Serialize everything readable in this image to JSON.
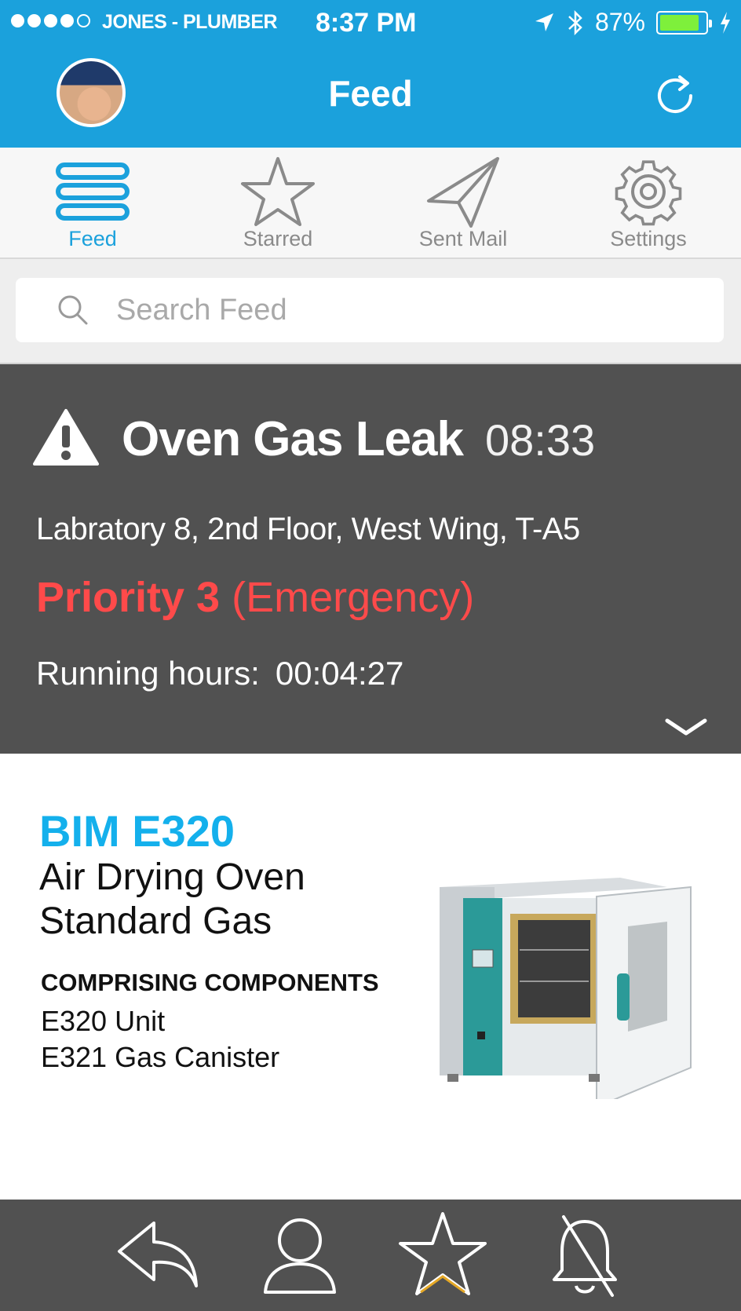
{
  "status_bar": {
    "carrier": "JONES - PLUMBER",
    "time": "8:37 PM",
    "battery": "87%",
    "battery_level": 0.87
  },
  "nav": {
    "title": "Feed"
  },
  "tabs": [
    {
      "label": "Feed",
      "icon": "list-icon",
      "active": true
    },
    {
      "label": "Starred",
      "icon": "star-icon",
      "active": false
    },
    {
      "label": "Sent Mail",
      "icon": "paper-plane-icon",
      "active": false
    },
    {
      "label": "Settings",
      "icon": "gear-icon",
      "active": false
    }
  ],
  "search": {
    "placeholder": "Search Feed",
    "value": ""
  },
  "alert": {
    "title": "Oven Gas Leak",
    "time": "08:33",
    "location": "Labratory 8, 2nd Floor, West Wing, T-A5",
    "priority_level": "Priority 3",
    "priority_type": "(Emergency)",
    "running_label": "Running hours:",
    "running_value": "00:04:27"
  },
  "product": {
    "model": "BIM E320",
    "desc_line1": "Air Drying Oven",
    "desc_line2": "Standard Gas",
    "components_heading": "COMPRISING COMPONENTS",
    "components": [
      "E320 Unit",
      "E321 Gas Canister"
    ]
  },
  "colors": {
    "header_blue": "#1ba1dc",
    "alert_bg": "#515151",
    "priority_red": "#ff4a4a",
    "model_blue": "#14b0ec",
    "battery_green": "#7ef03b"
  },
  "toolbar": {
    "icons": [
      "reply-icon",
      "user-icon",
      "star-icon",
      "bell-off-icon"
    ]
  }
}
